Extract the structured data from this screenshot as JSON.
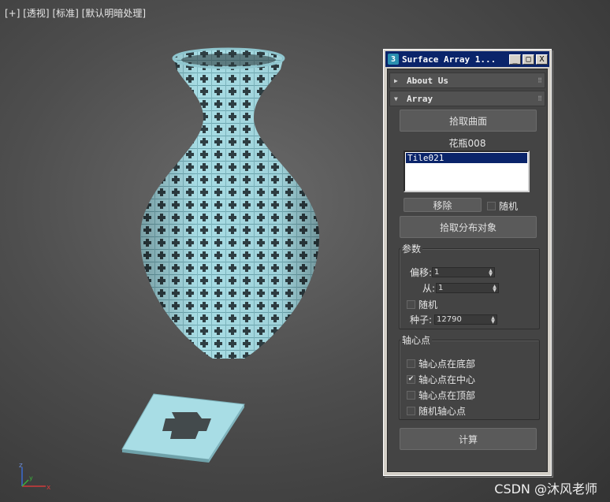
{
  "viewport": {
    "labels": [
      "[+]",
      "[透视]",
      "[标准]",
      "[默认明暗处理]"
    ],
    "axis": {
      "x": "x",
      "y": "y",
      "z": "z"
    },
    "watermark": "CSDN @沐风老师"
  },
  "panel": {
    "icon": "3",
    "title": "Surface Array 1...",
    "window_buttons": [
      "_",
      "□",
      "X"
    ],
    "rollouts": {
      "about": {
        "label": "About Us",
        "collapsed": true
      },
      "array": {
        "label": "Array",
        "collapsed": false
      }
    },
    "pick_surface_button": "拾取曲面",
    "surface_name": "花瓶008",
    "tile_list": [
      "Tile021"
    ],
    "remove_button": "移除",
    "random_checkbox": {
      "label": "随机",
      "checked": false
    },
    "pick_distribution_button": "拾取分布对象",
    "params": {
      "title": "参数",
      "offset": {
        "label": "偏移:",
        "value": "1"
      },
      "from": {
        "label": "从:",
        "value": "1"
      },
      "random": {
        "label": "随机",
        "checked": false
      },
      "seed": {
        "label": "种子:",
        "value": "12790"
      }
    },
    "pivot": {
      "title": "轴心点",
      "options": [
        {
          "label": "轴心点在底部",
          "checked": false
        },
        {
          "label": "轴心点在中心",
          "checked": true
        },
        {
          "label": "轴心点在顶部",
          "checked": false
        },
        {
          "label": "随机轴心点",
          "checked": false
        }
      ]
    },
    "compute_button": "计算"
  },
  "colors": {
    "viewport_bg": "#4e4e4e",
    "model": "#a6dbe3",
    "titlebar": "#0a246a",
    "selection": "#0a246a"
  }
}
